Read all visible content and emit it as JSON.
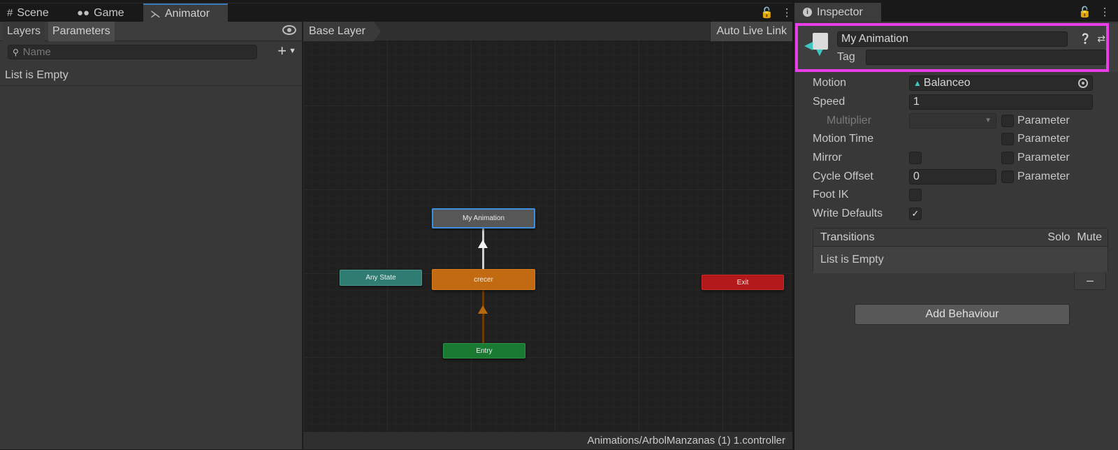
{
  "tabs": [
    {
      "label": "Scene",
      "icon": "grid-icon"
    },
    {
      "label": "Game",
      "icon": "gamepad-icon"
    },
    {
      "label": "Animator",
      "icon": "animator-icon"
    }
  ],
  "parameters_panel": {
    "tab_layers": "Layers",
    "tab_parameters": "Parameters",
    "search_placeholder": "Name",
    "empty_text": "List is Empty"
  },
  "graph": {
    "breadcrumb": "Base Layer",
    "auto_live_link": "Auto Live Link",
    "nodes": {
      "my_animation": "My Animation",
      "any_state": "Any State",
      "crecer": "crecer",
      "exit": "Exit",
      "entry": "Entry"
    },
    "controller_path": "Animations/ArbolManzanas (1) 1.controller"
  },
  "inspector": {
    "tab_label": "Inspector",
    "state_name": "My Animation",
    "tag_label": "Tag",
    "tag_value": "",
    "motion_label": "Motion",
    "motion_value": "Balanceo",
    "speed_label": "Speed",
    "speed_value": "1",
    "multiplier_label": "Multiplier",
    "motion_time_label": "Motion Time",
    "mirror_label": "Mirror",
    "cycle_offset_label": "Cycle Offset",
    "cycle_offset_value": "0",
    "foot_ik_label": "Foot IK",
    "write_defaults_label": "Write Defaults",
    "parameter_label": "Parameter",
    "transitions_label": "Transitions",
    "solo_label": "Solo",
    "mute_label": "Mute",
    "transitions_empty": "List is Empty",
    "add_behaviour_label": "Add Behaviour",
    "write_defaults_checked": true,
    "mirror_checked": false,
    "foot_ik_checked": false
  },
  "colors": {
    "accent_highlight": "#e83ee8",
    "selection_blue": "#3e8ede",
    "node_orange": "#c16a12",
    "node_teal": "#2f7d72",
    "node_red": "#b3191a",
    "node_green": "#1a7a32"
  }
}
